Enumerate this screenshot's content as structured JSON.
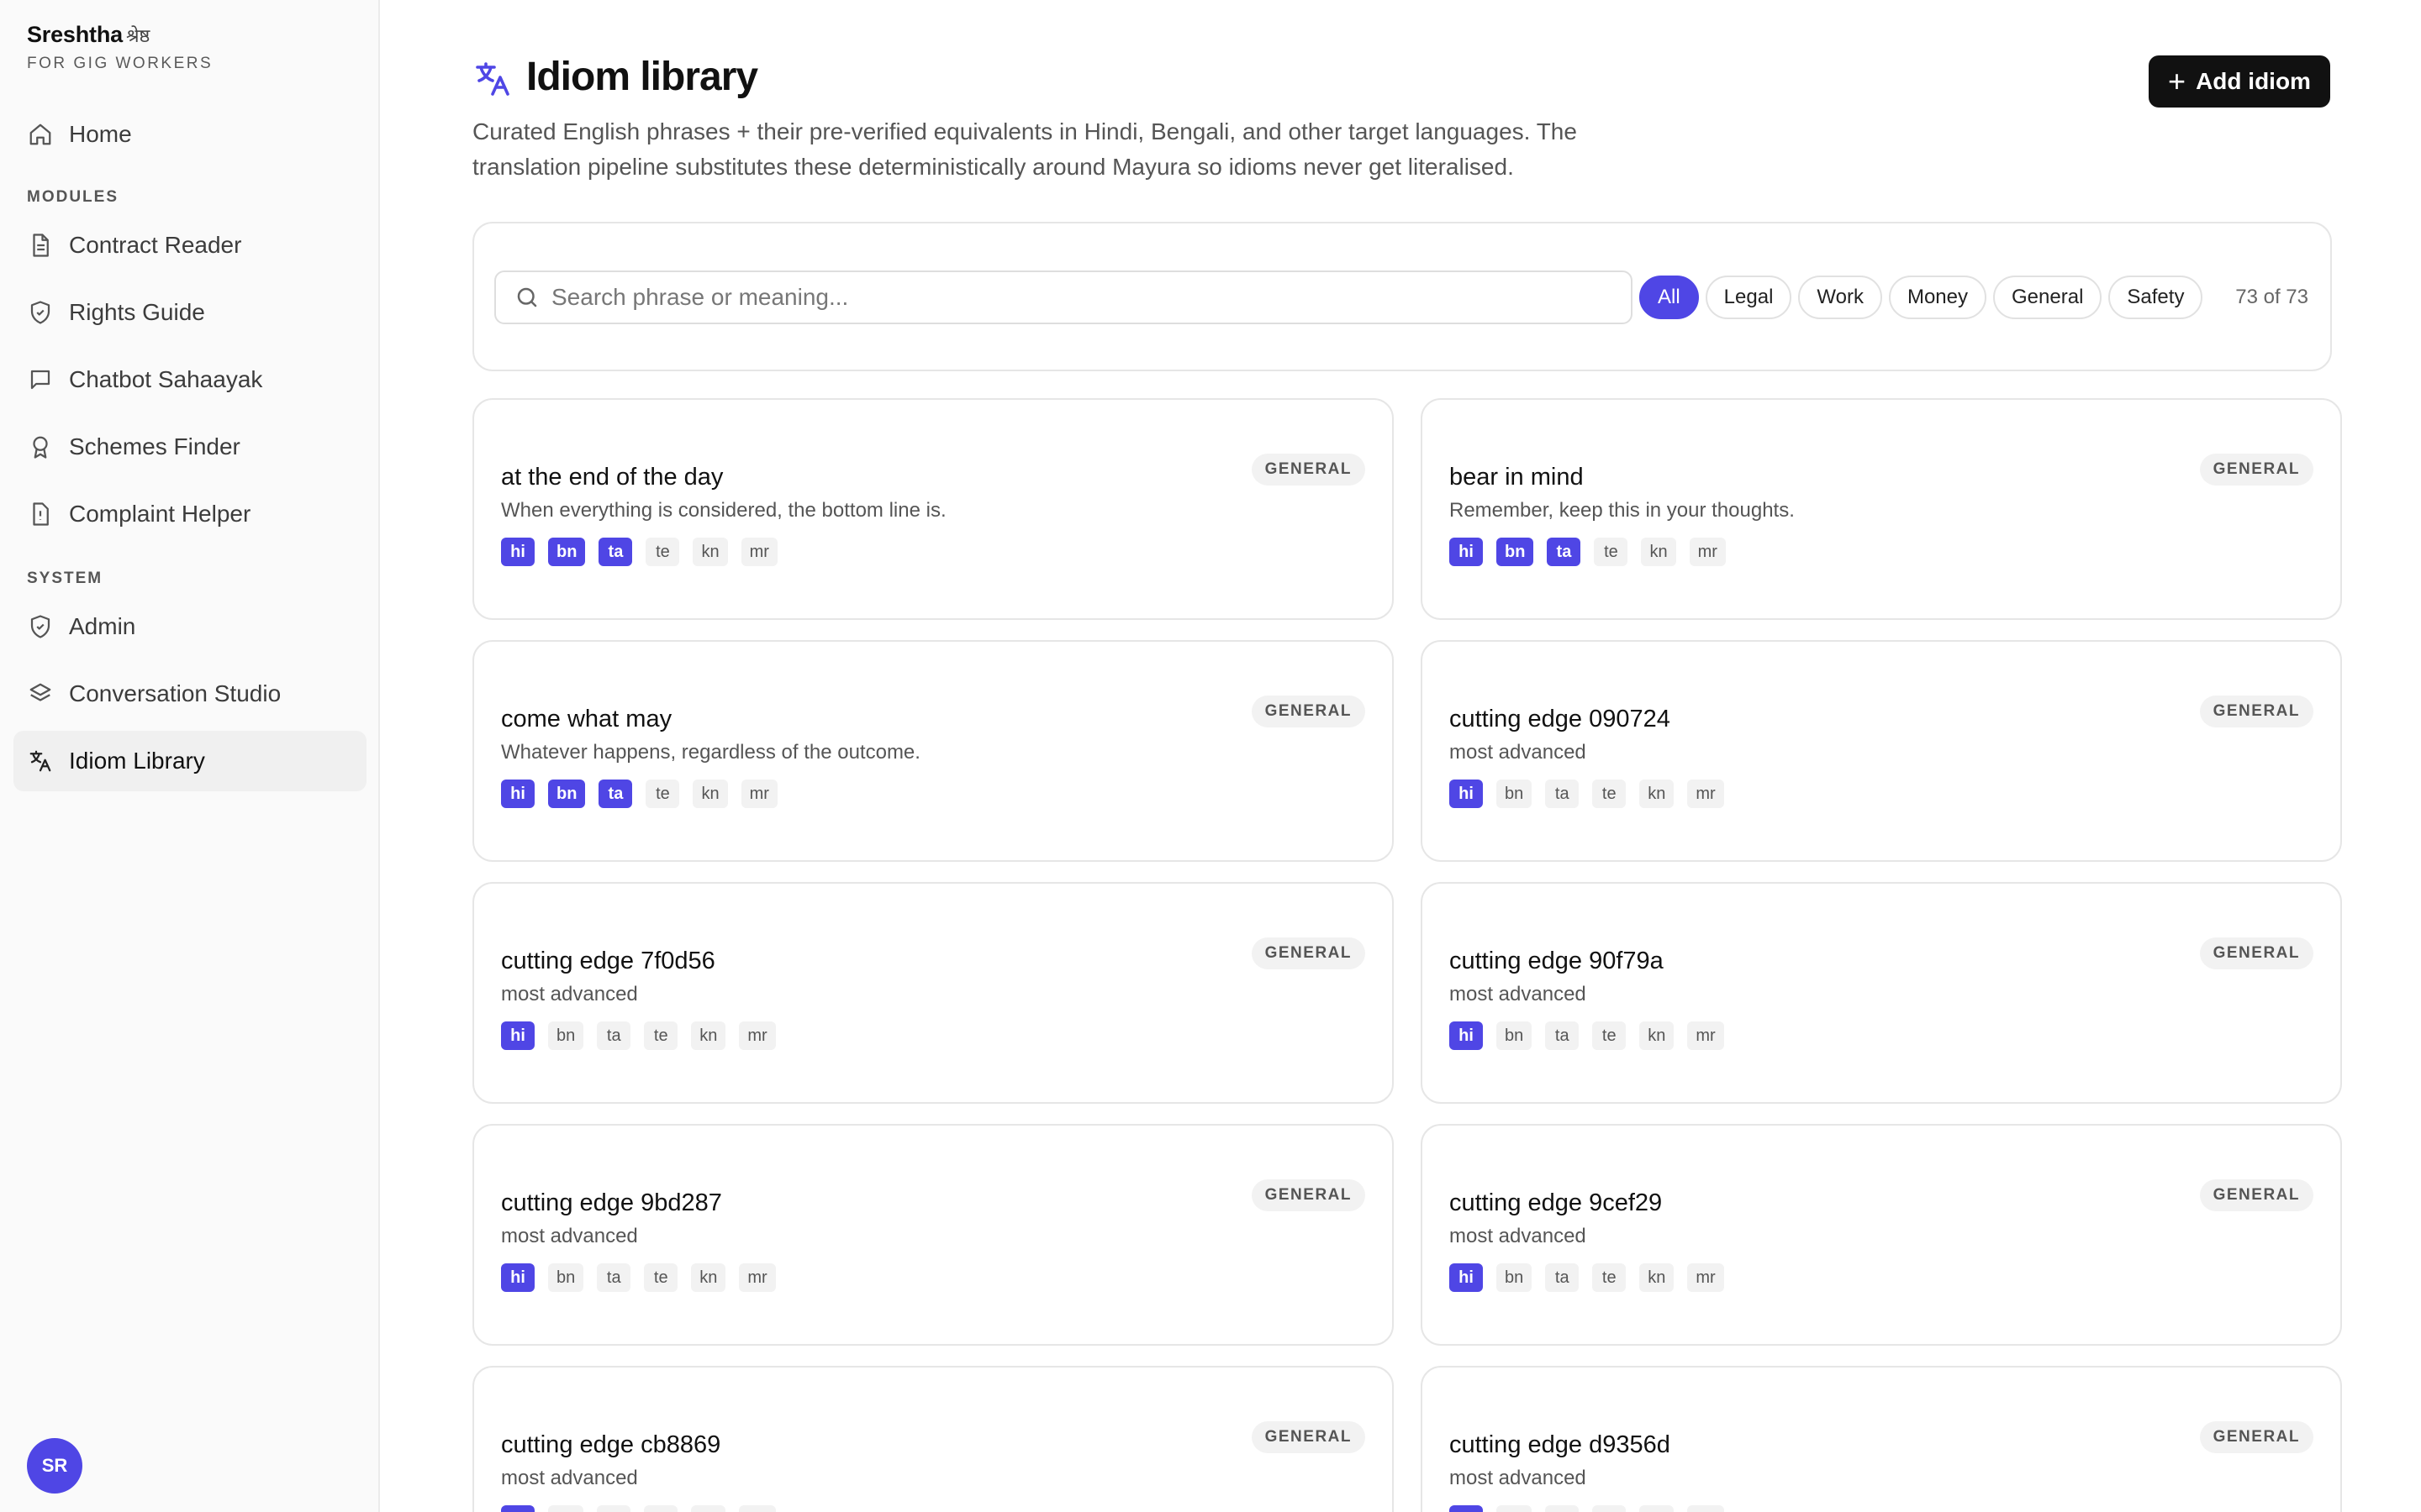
{
  "sidebar": {
    "brand_name": "Sreshtha",
    "brand_script": "श्रेष्ठ",
    "brand_sub": "FOR GIG WORKERS",
    "home": "Home",
    "modules_label": "MODULES",
    "modules": [
      "Contract Reader",
      "Rights Guide",
      "Chatbot Sahaayak",
      "Schemes Finder",
      "Complaint Helper"
    ],
    "system_label": "SYSTEM",
    "system": [
      "Admin",
      "Conversation Studio",
      "Idiom Library"
    ],
    "avatar": "SR"
  },
  "header": {
    "title": "Idiom library",
    "description": "Curated English phrases + their pre-verified equivalents in Hindi, Bengali, and other target languages. The translation pipeline substitutes these deterministically around Mayura so idioms never get literalised.",
    "add_button": "Add idiom"
  },
  "filters": {
    "search_placeholder": "Search phrase or meaning...",
    "chips": [
      "All",
      "Legal",
      "Work",
      "Money",
      "General",
      "Safety"
    ],
    "active_chip": "All",
    "count": "73 of 73"
  },
  "lang_codes": [
    "hi",
    "bn",
    "ta",
    "te",
    "kn",
    "mr"
  ],
  "idioms": [
    {
      "phrase": "at the end of the day",
      "meaning": "When everything is considered, the bottom line is.",
      "category": "GENERAL",
      "verified": 3
    },
    {
      "phrase": "bear in mind",
      "meaning": "Remember, keep this in your thoughts.",
      "category": "GENERAL",
      "verified": 3
    },
    {
      "phrase": "come what may",
      "meaning": "Whatever happens, regardless of the outcome.",
      "category": "GENERAL",
      "verified": 3
    },
    {
      "phrase": "cutting edge 090724",
      "meaning": "most advanced",
      "category": "GENERAL",
      "verified": 1
    },
    {
      "phrase": "cutting edge 7f0d56",
      "meaning": "most advanced",
      "category": "GENERAL",
      "verified": 1
    },
    {
      "phrase": "cutting edge 90f79a",
      "meaning": "most advanced",
      "category": "GENERAL",
      "verified": 1
    },
    {
      "phrase": "cutting edge 9bd287",
      "meaning": "most advanced",
      "category": "GENERAL",
      "verified": 1
    },
    {
      "phrase": "cutting edge 9cef29",
      "meaning": "most advanced",
      "category": "GENERAL",
      "verified": 1
    },
    {
      "phrase": "cutting edge cb8869",
      "meaning": "most advanced",
      "category": "GENERAL",
      "verified": 1
    },
    {
      "phrase": "cutting edge d9356d",
      "meaning": "most advanced",
      "category": "GENERAL",
      "verified": 1
    }
  ],
  "colors": {
    "accent": "#4f46e5",
    "dark_button": "#111111"
  }
}
